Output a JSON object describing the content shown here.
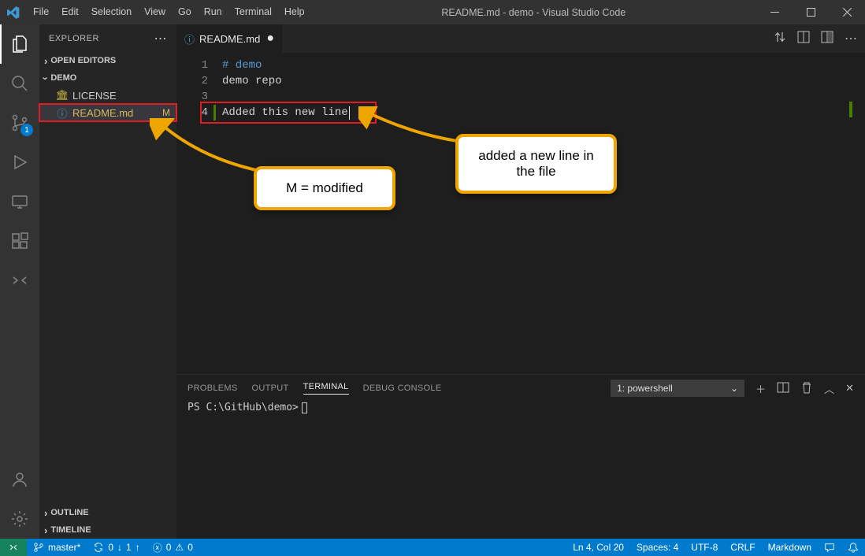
{
  "titlebar": {
    "menus": [
      "File",
      "Edit",
      "Selection",
      "View",
      "Go",
      "Run",
      "Terminal",
      "Help"
    ],
    "title": "README.md - demo - Visual Studio Code"
  },
  "activity": {
    "scm_badge": "1"
  },
  "sidebar": {
    "header": "EXPLORER",
    "sections": {
      "open_editors": "OPEN EDITORS",
      "folder": "DEMO",
      "outline": "OUTLINE",
      "timeline": "TIMELINE"
    },
    "files": [
      {
        "name": "LICENSE",
        "icon": "🏛",
        "status": ""
      },
      {
        "name": "README.md",
        "icon": "ⓘ",
        "status": "M"
      }
    ]
  },
  "tab": {
    "filename": "README.md",
    "dirty": "●"
  },
  "editor": {
    "line_numbers": [
      "1",
      "2",
      "3",
      "4"
    ],
    "line1_hash": "#",
    "line1_text": " demo",
    "line2": "demo repo",
    "line3": "",
    "line4": "Added this new line"
  },
  "panel": {
    "tabs": {
      "problems": "PROBLEMS",
      "output": "OUTPUT",
      "terminal": "TERMINAL",
      "debug": "DEBUG CONSOLE"
    },
    "terminal_selector": "1: powershell",
    "prompt": "PS C:\\GitHub\\demo>"
  },
  "statusbar": {
    "branch": "master*",
    "sync_down": "0",
    "sync_up": "1",
    "errors": "0",
    "warnings": "0",
    "cursor": "Ln 4, Col 20",
    "spaces": "Spaces: 4",
    "encoding": "UTF-8",
    "eol": "CRLF",
    "language": "Markdown"
  },
  "callouts": {
    "modified": "M = modified",
    "newline": "added a new line in the file"
  }
}
